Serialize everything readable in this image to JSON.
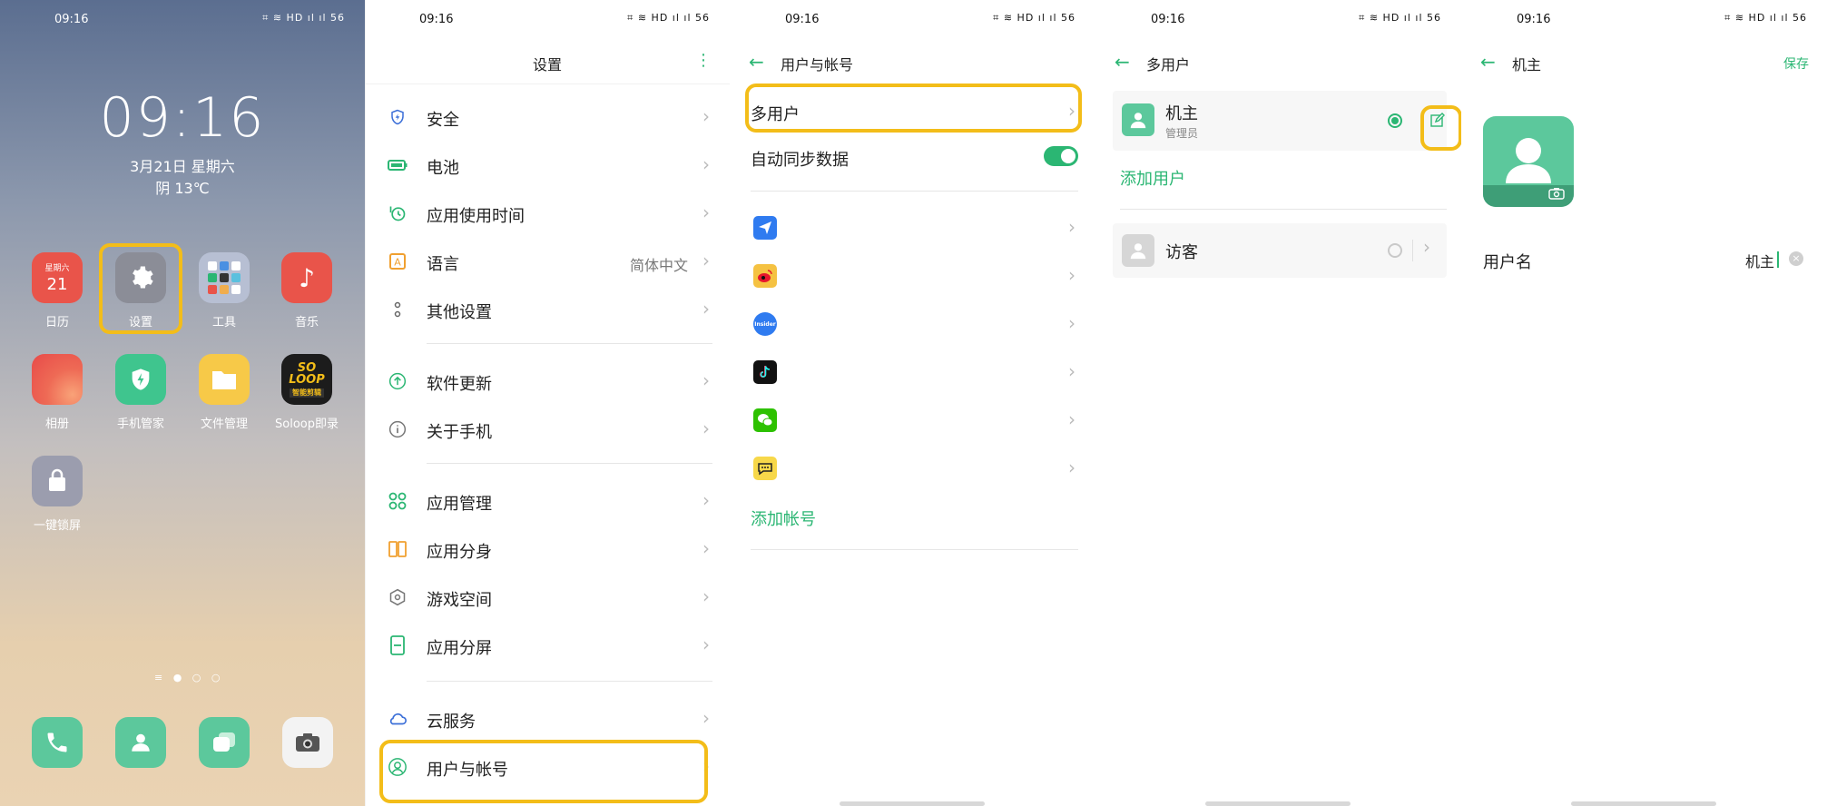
{
  "status_bar": {
    "time": "09:16",
    "icons": "⌗ ≋ HD ıl ıl 56"
  },
  "home": {
    "clock": "09:16",
    "date": "3月21日 星期六",
    "weather": "阴 13℃",
    "apps": [
      {
        "label": "日历",
        "tile_top": "星期六",
        "tile_main": "21"
      },
      {
        "label": "设置"
      },
      {
        "label": "工具"
      },
      {
        "label": "音乐"
      },
      {
        "label": "相册"
      },
      {
        "label": "手机管家"
      },
      {
        "label": "文件管理"
      },
      {
        "label": "Soloop即录",
        "tile_text": "SO LOOP",
        "tile_sub": "智能剪辑"
      },
      {
        "label": "一键锁屏"
      }
    ],
    "page_dots": "≡ ● ○ ○"
  },
  "settings": {
    "title": "设置",
    "items": [
      {
        "label": "安全"
      },
      {
        "label": "电池"
      },
      {
        "label": "应用使用时间"
      },
      {
        "label": "语言",
        "value": "简体中文"
      },
      {
        "label": "其他设置"
      },
      {
        "label": "软件更新"
      },
      {
        "label": "关于手机"
      },
      {
        "label": "应用管理"
      },
      {
        "label": "应用分身"
      },
      {
        "label": "游戏空间"
      },
      {
        "label": "应用分屏"
      },
      {
        "label": "云服务"
      },
      {
        "label": "用户与帐号"
      }
    ]
  },
  "accounts": {
    "title": "用户与帐号",
    "multi_user": "多用户",
    "auto_sync": "自动同步数据",
    "auto_sync_on": true,
    "add_account": "添加帐号",
    "icon_insider": "Insider"
  },
  "multiuser": {
    "title": "多用户",
    "owner_name": "机主",
    "owner_role": "管理员",
    "add_user": "添加用户",
    "guest": "访客"
  },
  "owner_edit": {
    "title": "机主",
    "save": "保存",
    "username_label": "用户名",
    "username_value": "机主"
  },
  "colors": {
    "accent": "#2bb673",
    "highlight": "#f3bd19"
  }
}
